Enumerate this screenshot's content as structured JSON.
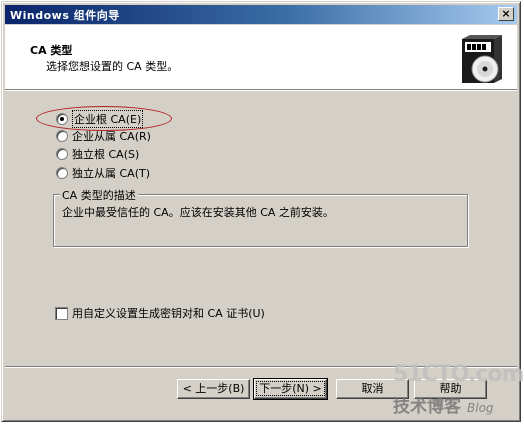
{
  "window": {
    "title": "Windows 组件向导",
    "close_glyph": "×"
  },
  "header": {
    "title": "CA 类型",
    "subtitle": "选择您想设置的 CA 类型。"
  },
  "ca_types": {
    "options": [
      {
        "label": "企业根 CA(E)",
        "checked": true
      },
      {
        "label": "企业从属 CA(R)",
        "checked": false
      },
      {
        "label": "独立根 CA(S)",
        "checked": false
      },
      {
        "label": "独立从属 CA(T)",
        "checked": false
      }
    ]
  },
  "description": {
    "group_title": "CA 类型的描述",
    "text": "企业中最受信任的 CA。应该在安装其他 CA 之前安装。"
  },
  "advanced": {
    "checkbox_label": "用自定义设置生成密钥对和 CA 证书(U)",
    "checked": false
  },
  "buttons": {
    "back": "< 上一步(B)",
    "next": "下一步(N) >",
    "cancel": "取消",
    "help": "帮助"
  },
  "watermark": {
    "site": "51CTO.com",
    "tagline": "技术博客",
    "blog": "Blog"
  },
  "colors": {
    "dialog_bg": "#d4d0c8",
    "titlebar_start": "#0a246a",
    "titlebar_end": "#a6caf0",
    "highlight_ring": "#b02020"
  },
  "icons": {
    "header_graphic": "cd-box-icon",
    "close": "close-icon"
  }
}
